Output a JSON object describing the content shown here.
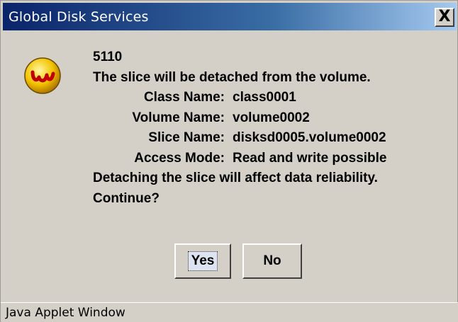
{
  "window": {
    "title": "Global Disk Services",
    "close_label": "X"
  },
  "icon": {
    "name": "warning-logo-icon",
    "letter": "ω",
    "color": "#f0c000"
  },
  "message": {
    "code": "5110",
    "headline": "The slice will be detached from the volume.",
    "details": [
      {
        "key": "Class Name:",
        "value": "class0001"
      },
      {
        "key": "Volume Name:",
        "value": "volume0002"
      },
      {
        "key": "Slice Name:",
        "value": "disksd0005.volume0002"
      },
      {
        "key": "Access Mode:",
        "value": "Read and write possible"
      }
    ],
    "warning": "Detaching the slice will affect data reliability.",
    "question": "Continue?"
  },
  "buttons": {
    "yes_label": "Yes",
    "no_label": "No"
  },
  "status": {
    "text": "Java Applet Window"
  }
}
